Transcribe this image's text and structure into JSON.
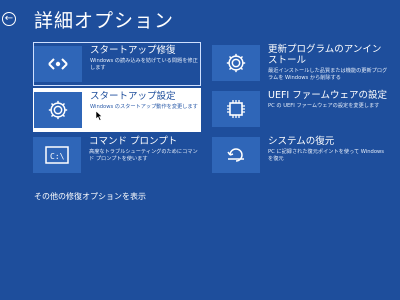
{
  "header": {
    "title": "詳細オプション",
    "back_icon": "back-arrow-icon"
  },
  "tiles": [
    {
      "title": "スタートアップ修復",
      "desc": "Windows の読み込みを妨げている問題を修正します",
      "icon": "startup-repair-icon"
    },
    {
      "title": "更新プログラムのアンインストール",
      "desc": "最近インストールした品質または機能の更新プログラムを Windows から削除する",
      "icon": "gear-icon"
    },
    {
      "title": "スタートアップ設定",
      "desc": "Windows のスタートアップ動作を変更します",
      "icon": "gear-icon"
    },
    {
      "title": "UEFI ファームウェアの設定",
      "desc": "PC の UEFI ファームウェアの設定を変更します",
      "icon": "chip-icon"
    },
    {
      "title": "コマンド プロンプト",
      "desc": "高度なトラブルシューティングのためにコマンド プロンプトを使います",
      "icon": "command-prompt-icon"
    },
    {
      "title": "システムの復元",
      "desc": "PC に記録された復元ポイントを使って Windows を復元",
      "icon": "system-restore-icon"
    }
  ],
  "more_link": "その他の修復オプションを表示",
  "colors": {
    "background": "#1e4e9c",
    "icon_box": "#2f66b8",
    "text": "#ffffff"
  }
}
